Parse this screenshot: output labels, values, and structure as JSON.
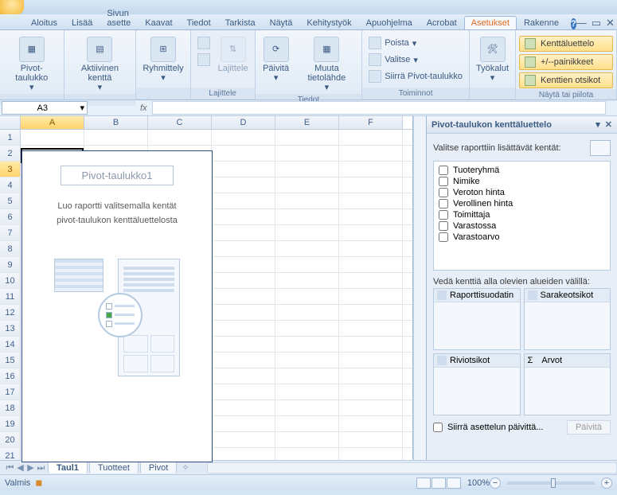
{
  "tabs": {
    "items": [
      "Aloitus",
      "Lisää",
      "Sivun asette",
      "Kaavat",
      "Tiedot",
      "Tarkista",
      "Näytä",
      "Kehitystyök",
      "Apuohjelma",
      "Acrobat",
      "Asetukset",
      "Rakenne"
    ],
    "active": 10
  },
  "ribbon": {
    "group1": {
      "pivot": "Pivot-taulukko",
      "active": "Aktiivinen kenttä",
      "group": "Ryhmittely"
    },
    "sort": {
      "label": "Lajittele",
      "btn": "Lajittele"
    },
    "data": {
      "label": "Tiedot",
      "refresh": "Päivitä",
      "source": "Muuta tietolähde"
    },
    "actions": {
      "label": "Toiminnot",
      "clear": "Poista",
      "select": "Valitse",
      "move": "Siirrä Pivot-taulukko"
    },
    "tools": {
      "label": "",
      "btn": "Työkalut"
    },
    "show": {
      "label": "Näytä tai piilota",
      "fieldlist": "Kenttäluettelo",
      "buttons": "+/--painikkeet",
      "headers": "Kenttien otsikot"
    }
  },
  "namebox": "A3",
  "fx": "fx",
  "columns": [
    "A",
    "B",
    "C",
    "D",
    "E",
    "F"
  ],
  "rows21": [
    "1",
    "2",
    "3",
    "4",
    "5",
    "6",
    "7",
    "8",
    "9",
    "10",
    "11",
    "12",
    "13",
    "14",
    "15",
    "16",
    "17",
    "18",
    "19",
    "20",
    "21"
  ],
  "pivotPH": {
    "title": "Pivot-taulukko1",
    "line1": "Luo raportti valitsemalla kentät",
    "line2": "pivot-taulukon kenttäluettelosta"
  },
  "fieldlist": {
    "title": "Pivot-taulukon kenttäluettelo",
    "choose": "Valitse raporttiin lisättävät kentät:",
    "fields": [
      "Tuoteryhmä",
      "Nimike",
      "Veroton hinta",
      "Verollinen hinta",
      "Toimittaja",
      "Varastossa",
      "Varastoarvo"
    ],
    "drag": "Vedä kenttiä alla olevien alueiden välillä:",
    "zones": {
      "filter": "Raporttisuodatin",
      "cols": "Sarakeotsikot",
      "rows": "Riviotsikot",
      "vals": "Arvot",
      "sigma": "Σ"
    },
    "defer": "Siirrä asettelun päivittä...",
    "update": "Päivitä"
  },
  "sheets": {
    "items": [
      "Taul1",
      "Tuotteet",
      "Pivot"
    ],
    "active": 0
  },
  "status": {
    "ready": "Valmis",
    "zoom": "100%"
  }
}
